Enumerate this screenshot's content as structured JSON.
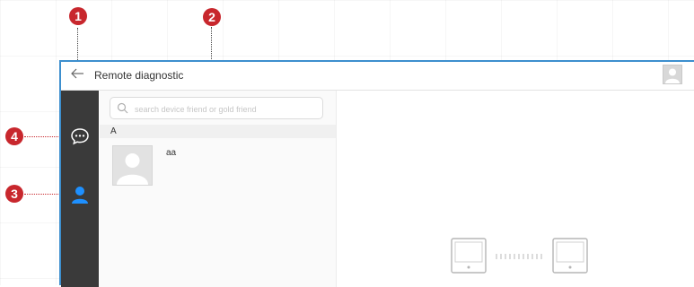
{
  "markers": [
    "1",
    "2",
    "3",
    "4"
  ],
  "titlebar": {
    "back_icon": "arrow-left-icon",
    "title": "Remote diagnostic",
    "avatar_icon": "user-avatar-icon"
  },
  "sidebar": {
    "items": [
      {
        "icon": "chat-bubble-icon",
        "color": "#ffffff"
      },
      {
        "icon": "contacts-person-icon",
        "color": "#1e90ff"
      }
    ]
  },
  "search": {
    "placeholder": "search device friend or gold friend",
    "value": ""
  },
  "contacts": {
    "section_letter": "A",
    "items": [
      {
        "name": "aa",
        "avatar_icon": "default-user-avatar"
      }
    ]
  },
  "chat_area": {
    "empty_state_icon": "device-connection-icon"
  },
  "colors": {
    "marker": "#c8272d",
    "window_border": "#3d8fce",
    "sidebar_bg": "#3a3a3a",
    "active_icon": "#1e90ff"
  }
}
